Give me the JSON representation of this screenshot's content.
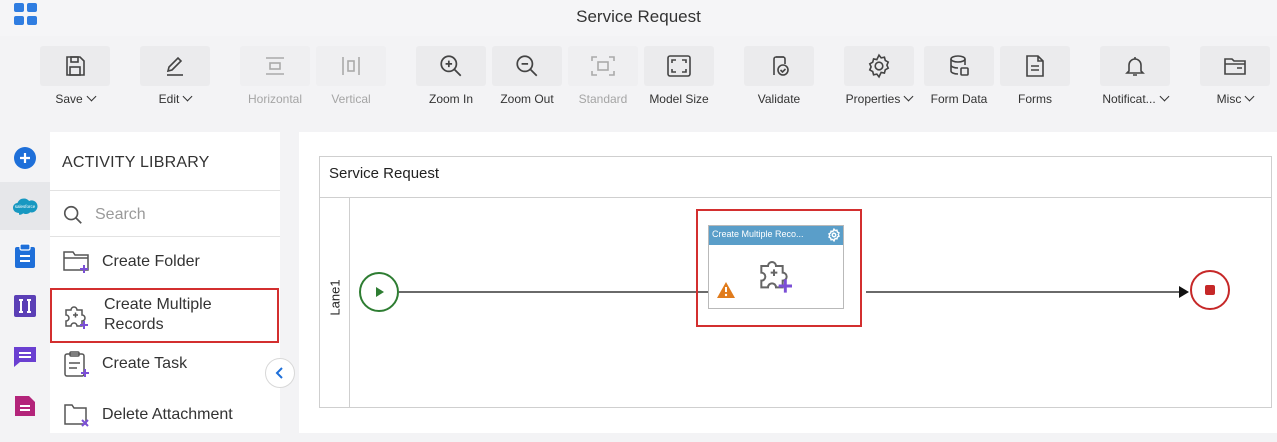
{
  "header": {
    "title": "Service Request"
  },
  "toolbar": {
    "save": "Save",
    "edit": "Edit",
    "horizontal": "Horizontal",
    "vertical": "Vertical",
    "zoom_in": "Zoom In",
    "zoom_out": "Zoom Out",
    "standard": "Standard",
    "model_size": "Model Size",
    "validate": "Validate",
    "properties": "Properties",
    "form_data": "Form Data",
    "forms": "Forms",
    "notifications": "Notificat...",
    "misc": "Misc"
  },
  "rail": {
    "items": [
      "add-icon",
      "salesforce-icon",
      "clipboard-icon",
      "text-field-icon",
      "message-icon",
      "form-icon"
    ],
    "salesforce_text": "salesforce"
  },
  "library": {
    "title": "ACTIVITY LIBRARY",
    "search_placeholder": "Search",
    "items": [
      {
        "label": "Create Folder",
        "icon": "folder-add-icon"
      },
      {
        "label": "Create Multiple Records",
        "label_line1": "Create Multiple",
        "label_line2": "Records",
        "icon": "puzzle-add-icon",
        "selected": true
      },
      {
        "label": "Create Task",
        "icon": "task-add-icon"
      },
      {
        "label": "Delete Attachment",
        "icon": "attachment-delete-icon"
      }
    ]
  },
  "canvas": {
    "pool_title": "Service Request",
    "lane_label": "Lane1",
    "activity": {
      "title": "Create Multiple Reco...",
      "warning": true
    },
    "colors": {
      "start": "#2e7d32",
      "end": "#c62828",
      "activity_header": "#5a9ec9",
      "selection": "#d32f2f"
    }
  }
}
